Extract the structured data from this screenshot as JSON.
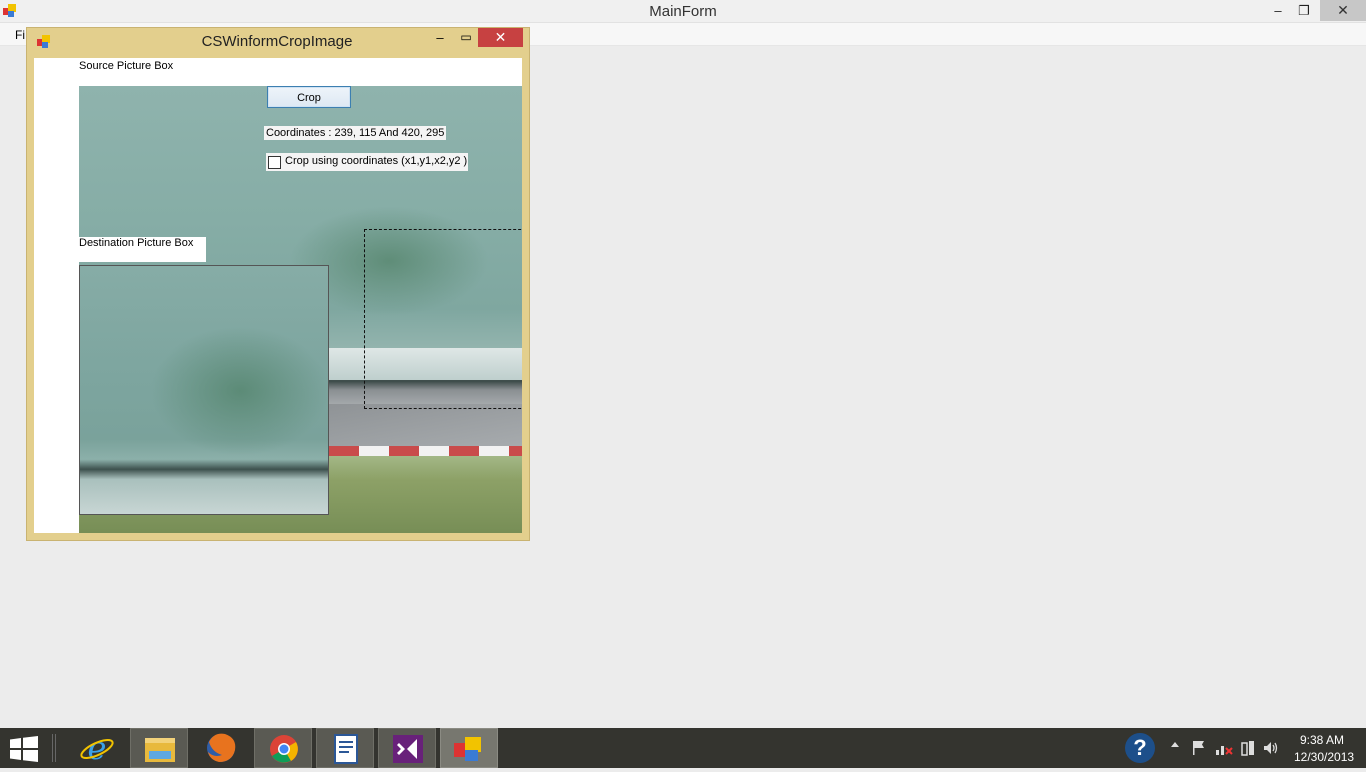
{
  "main_window": {
    "title": "MainForm",
    "minimize": "–",
    "restore": "❐",
    "close": "✕",
    "menu_file": "Fi"
  },
  "child_window": {
    "title": "CSWinformCropImage",
    "minimize": "–",
    "maximize": "▭",
    "close": "✕",
    "source_label": "Source Picture Box",
    "crop_button": "Crop",
    "coordinates_text": "Coordinates  :  239, 115 And 420, 295",
    "checkbox_label": "Crop using coordinates (x1,y1,x2,y2 )",
    "checkbox_checked": false,
    "destination_label": "Destination Picture Box"
  },
  "taskbar": {
    "apps": [
      "start",
      "internet-explorer",
      "file-explorer",
      "firefox",
      "chrome",
      "document-app",
      "visual-studio",
      "winform-app"
    ],
    "tray_icons": [
      "help-icon",
      "show-hidden-icons-arrow",
      "action-center-flag-icon",
      "network-icon",
      "power-icon",
      "volume-icon"
    ],
    "time": "9:38 AM",
    "date": "12/30/2013"
  },
  "colors": {
    "child_frame": "#e3cf8d",
    "child_close": "#c74141",
    "taskbar": "#34342f",
    "desktop": "#ececec"
  }
}
